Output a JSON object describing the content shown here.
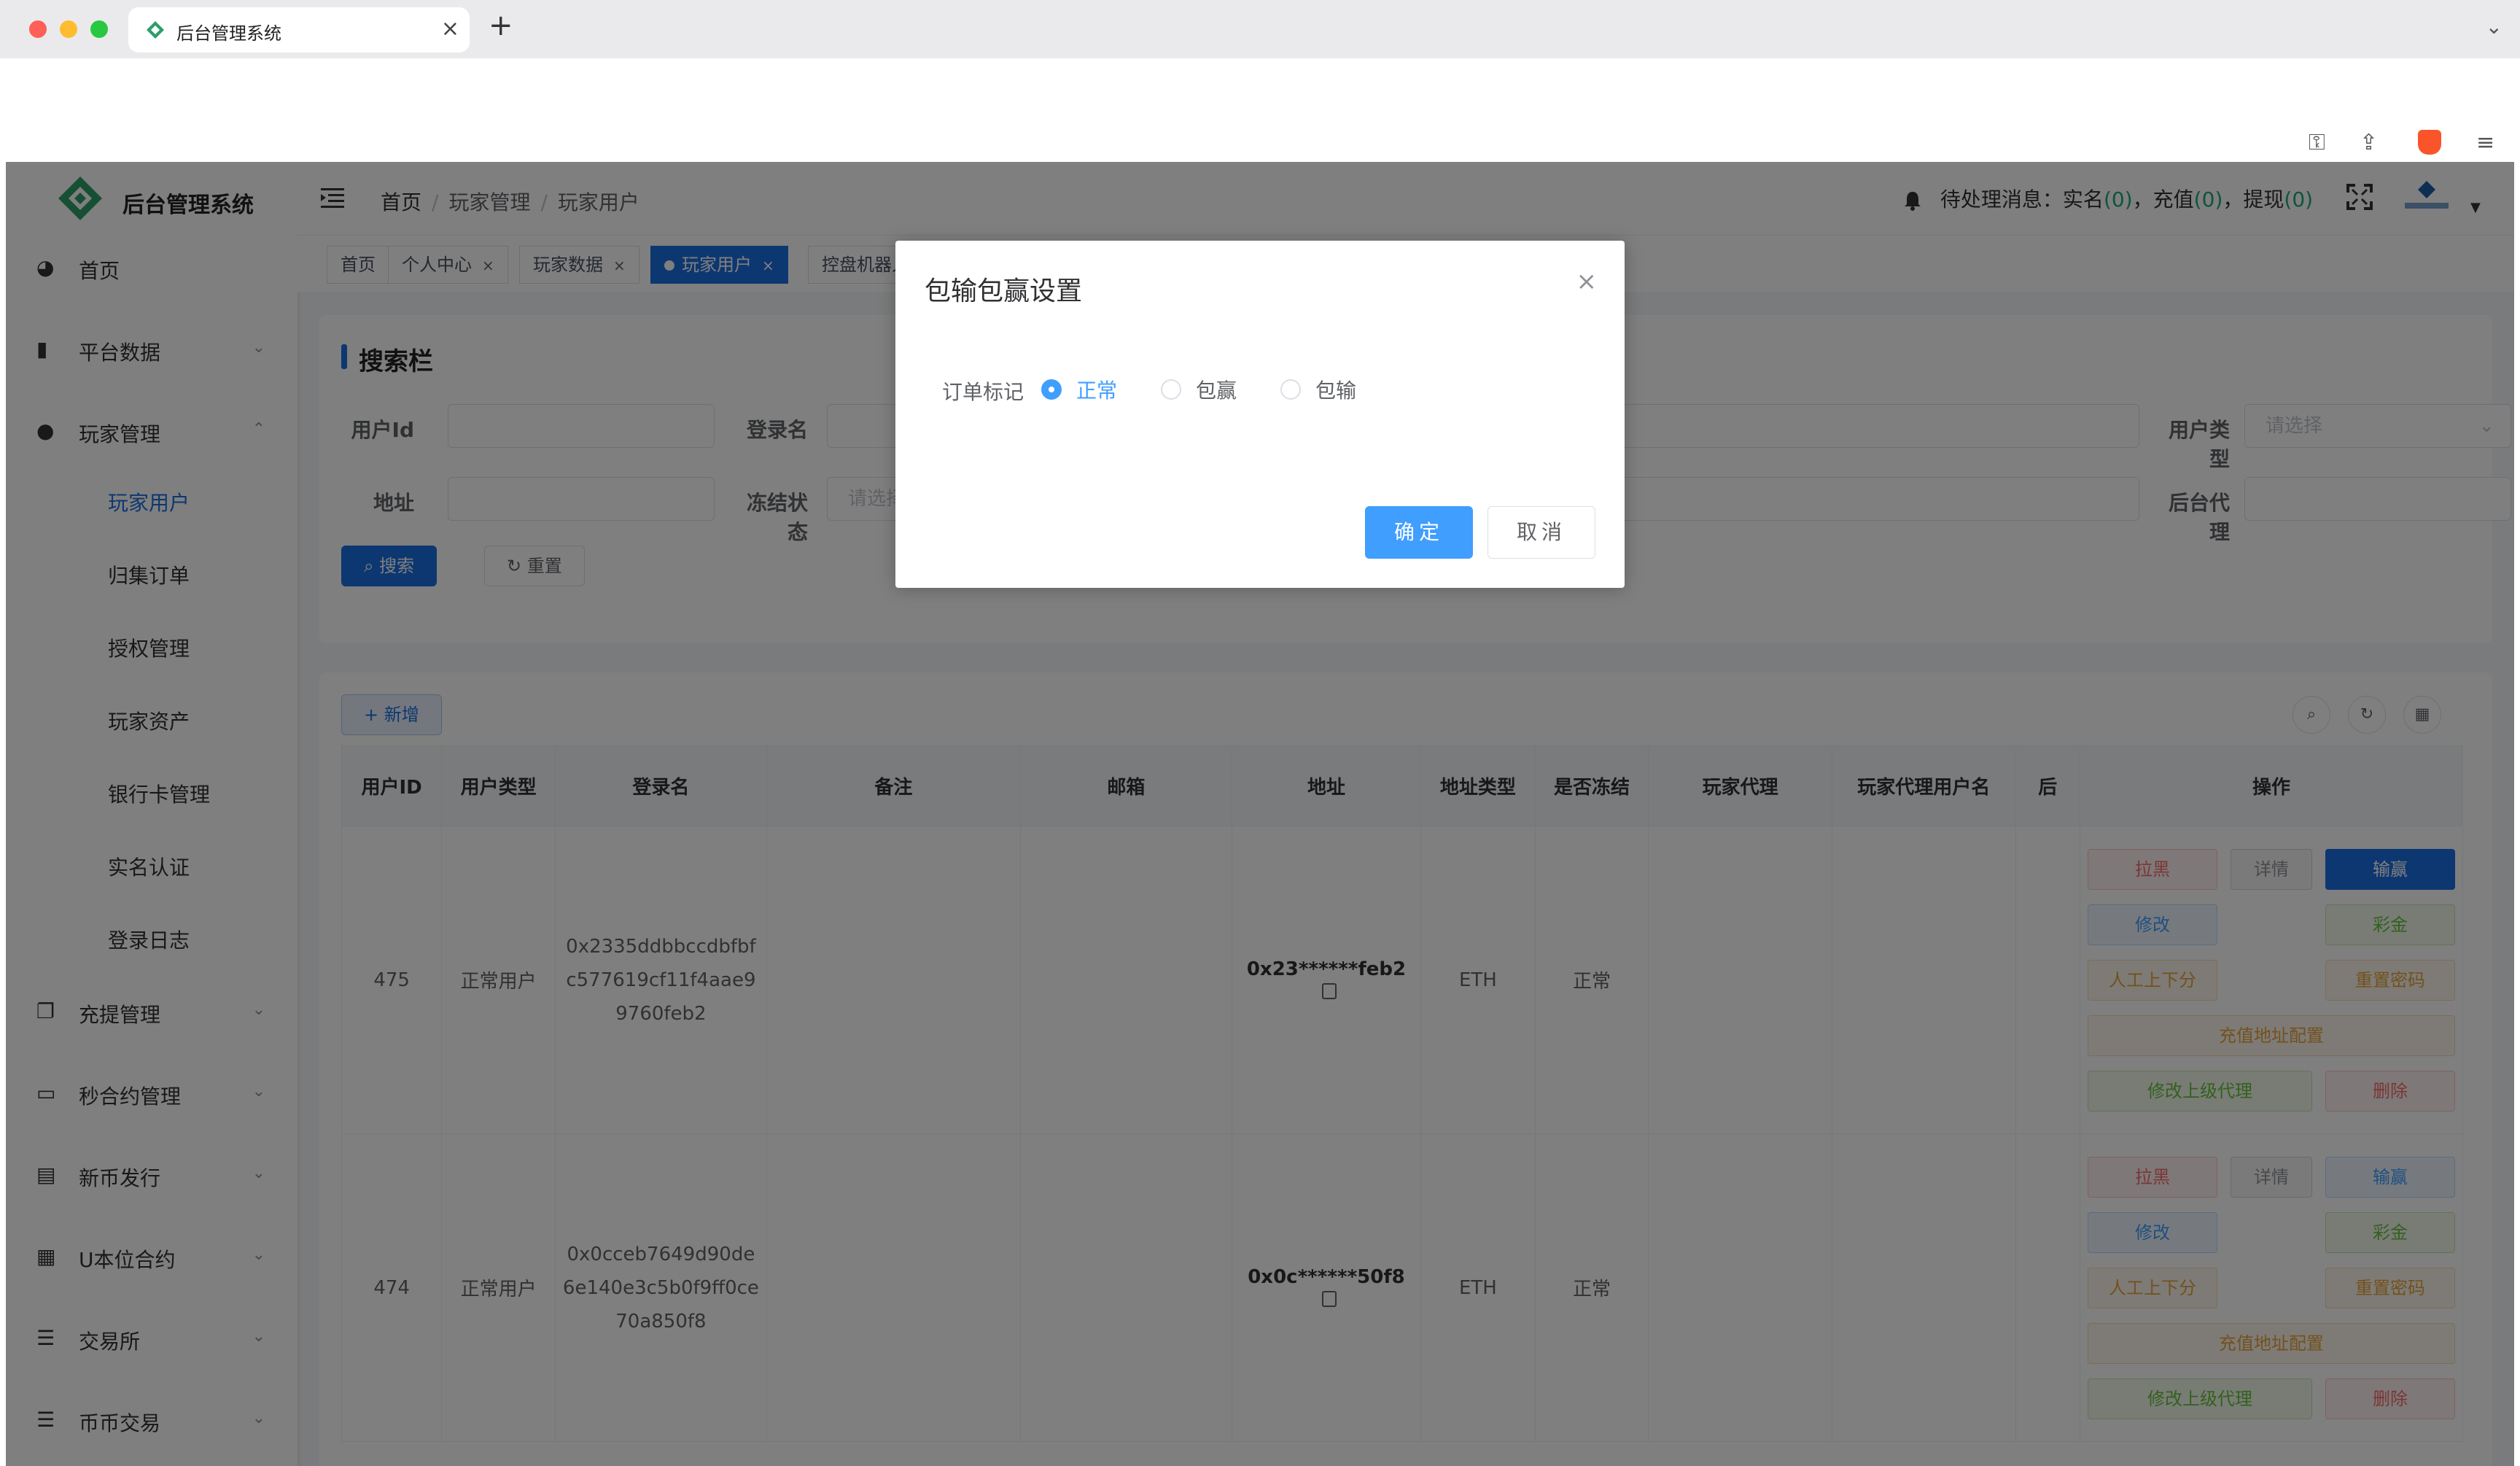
{
  "browser": {
    "tab_title": "后台管理系统",
    "tab_close": "×",
    "new_tab": "+"
  },
  "app": {
    "logo_text": "后台管理系统"
  },
  "sidebar": {
    "menu": [
      {
        "label": "首页",
        "icon": "dashboard-icon"
      },
      {
        "label": "平台数据",
        "icon": "book-icon"
      },
      {
        "label": "玩家管理",
        "icon": "user-icon"
      },
      {
        "label": "充提管理",
        "icon": "documents-icon"
      },
      {
        "label": "秒合约管理",
        "icon": "monitor-icon"
      },
      {
        "label": "新币发行",
        "icon": "newspaper-icon"
      },
      {
        "label": "U本位合约",
        "icon": "grid-icon"
      },
      {
        "label": "交易所",
        "icon": "list-icon"
      },
      {
        "label": "币币交易",
        "icon": "list-icon"
      }
    ],
    "sub_items": [
      "玩家用户",
      "归集订单",
      "授权管理",
      "玩家资产",
      "银行卡管理",
      "实名认证",
      "登录日志"
    ]
  },
  "header": {
    "breadcrumbs": [
      "首页",
      "玩家管理",
      "玩家用户"
    ],
    "notice_label": "待处理消息：",
    "realname_label": "实名",
    "recharge_label": "充值",
    "withdraw_label": "提现",
    "realname_count": "0",
    "recharge_count": "0",
    "withdraw_count": "0"
  },
  "tags": [
    {
      "label": "首页",
      "closable": false
    },
    {
      "label": "个人中心",
      "closable": true
    },
    {
      "label": "玩家数据",
      "closable": true
    },
    {
      "label": "玩家用户",
      "closable": true,
      "active": true
    },
    {
      "label": "控盘机器人",
      "closable": false
    }
  ],
  "search": {
    "title": "搜索栏",
    "fields": {
      "user_id": "用户Id",
      "login_name": "登录名",
      "user_type": "用户类型",
      "address": "地址",
      "frozen_status": "冻结状态",
      "backend_agent": "后台代理"
    },
    "select_placeholder": "请选择",
    "frozen_placeholder": "请选择",
    "search_btn": "搜索",
    "reset_btn": "重置"
  },
  "table": {
    "add_btn": "新增",
    "columns": [
      "用户ID",
      "用户类型",
      "登录名",
      "备注",
      "邮箱",
      "地址",
      "地址类型",
      "是否冻结",
      "玩家代理",
      "玩家代理用户名",
      "后",
      "操作"
    ],
    "rows": [
      {
        "id": "475",
        "type": "正常用户",
        "login": "0x2335ddbbccdbfbfc577619cf11f4aae99760feb2",
        "remark": "",
        "email": "",
        "address": "0x23******feb2",
        "addr_type": "ETH",
        "frozen": "正常",
        "agent": "",
        "agent_user": ""
      },
      {
        "id": "474",
        "type": "正常用户",
        "login": "0x0cceb7649d90de6e140e3c5b0f9ff0ce70a850f8",
        "remark": "",
        "email": "",
        "address": "0x0c******50f8",
        "addr_type": "ETH",
        "frozen": "正常",
        "agent": "",
        "agent_user": ""
      }
    ],
    "ops": {
      "blacklist": "拉黑",
      "detail": "详情",
      "lose_win": "输赢",
      "edit": "修改",
      "bonus": "彩金",
      "manual": "人工上下分",
      "reset_pwd": "重置密码",
      "recharge_addr": "充值地址配置",
      "edit_agent": "修改上级代理",
      "delete": "删除"
    }
  },
  "dialog": {
    "title": "包输包赢设置",
    "close": "×",
    "field_label": "订单标记",
    "options": [
      "正常",
      "包赢",
      "包输"
    ],
    "selected": "正常",
    "ok": "确定",
    "cancel": "取消"
  },
  "colors": {
    "primary": "#1b6fe2",
    "radio_active": "#409eff",
    "notice_count": "#1fa87a",
    "mask": "rgba(0,0,0,0.5)"
  }
}
